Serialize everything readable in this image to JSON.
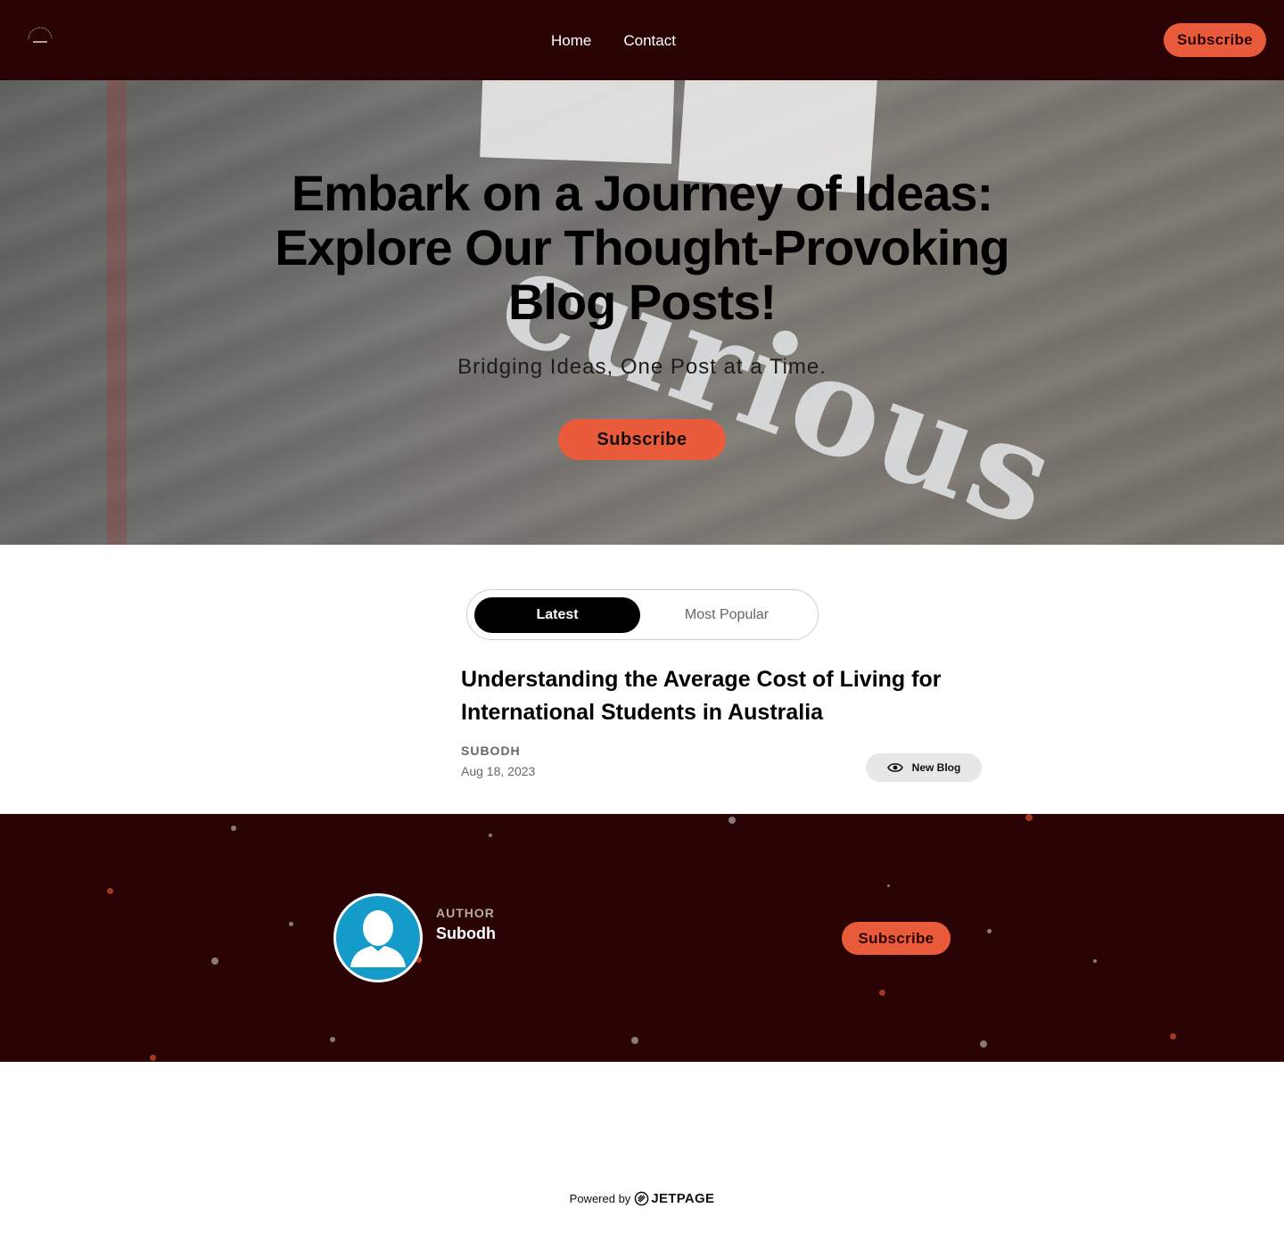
{
  "header": {
    "nav": [
      {
        "label": "Home"
      },
      {
        "label": "Contact"
      }
    ],
    "subscribe_label": "Subscribe"
  },
  "hero": {
    "title": "Embark on a Journey of Ideas: Explore Our Thought-Provoking Blog Posts!",
    "subtitle": "Bridging Ideas, One Post at a Time.",
    "subscribe_label": "Subscribe",
    "background_word": "curious"
  },
  "tabs": [
    {
      "label": "Latest",
      "active": true
    },
    {
      "label": "Most Popular",
      "active": false
    }
  ],
  "post": {
    "title": "Understanding the Average Cost of Living for International Students in Australia",
    "author": "SUBODH",
    "date": "Aug 18, 2023",
    "badge_label": "New Blog",
    "badge_icon": "eye-icon"
  },
  "author_section": {
    "label": "AUTHOR",
    "name": "Subodh",
    "subscribe_label": "Subscribe",
    "avatar_icon": "user-silhouette-icon"
  },
  "footer": {
    "powered_by": "Powered by",
    "brand": "JETPAGE"
  },
  "colors": {
    "header_bg": "#2a0304",
    "accent": "#ea5b3b",
    "avatar_bg": "#159bc9"
  }
}
